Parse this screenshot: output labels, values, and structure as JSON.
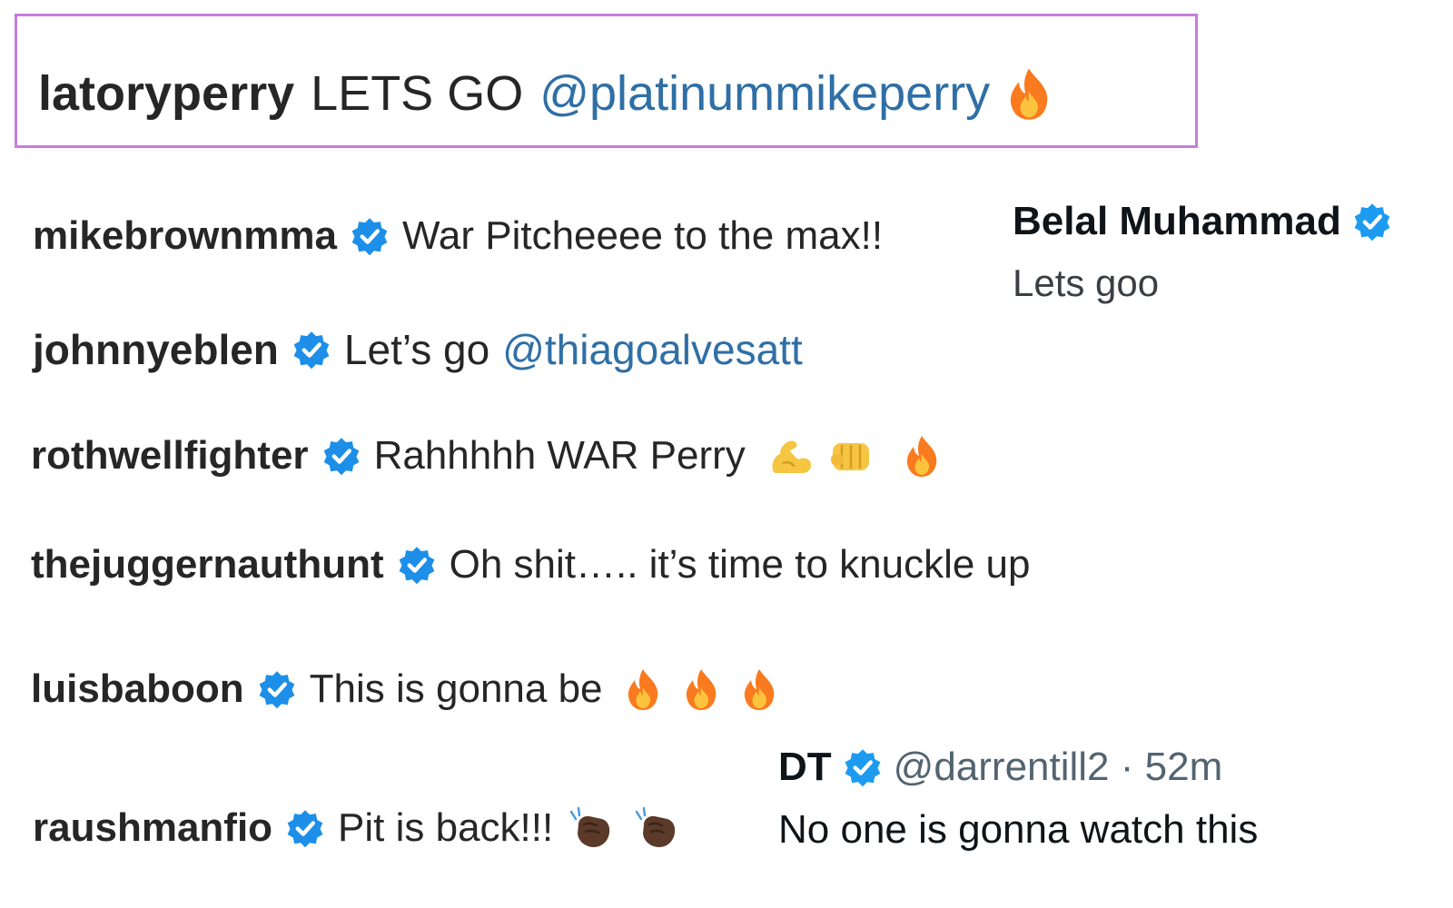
{
  "highlight": {
    "username": "latoryperry",
    "text": "LETS GO",
    "mention": "@platinummikeperry",
    "emoji": "fire"
  },
  "comments": [
    {
      "username": "mikebrownmma",
      "verified": true,
      "text": "War Pitcheeee to the max!!"
    },
    {
      "username": "johnnyeblen",
      "verified": true,
      "text": "Let’s go",
      "mention": "@thiagoalvesatt"
    },
    {
      "username": "rothwellfighter",
      "verified": true,
      "text": "Rahhhhh WAR Perry",
      "emojis": [
        "flexed-biceps",
        "raised-fist",
        "fire"
      ]
    },
    {
      "username": "thejuggernauthunt",
      "verified": true,
      "text": "Oh shit….. it’s time to knuckle up"
    },
    {
      "username": "luisbaboon",
      "verified": true,
      "text": "This is gonna be",
      "emojis": [
        "fire",
        "fire",
        "fire"
      ]
    },
    {
      "username": "raushmanfio",
      "verified": true,
      "text": "Pit is back!!!",
      "emojis": [
        "clapping-hands",
        "clapping-hands"
      ]
    }
  ],
  "tweet_belal": {
    "name": "Belal Muhammad",
    "verified": true,
    "text": "Lets goo"
  },
  "tweet_dt": {
    "name": "DT",
    "verified": true,
    "handle_time": "@darrentill2 · 52m",
    "text": "No one is gonna watch this"
  },
  "colors": {
    "instagram_verified": "#1d8fe8",
    "twitter_verified": "#1d9bf0",
    "mention": "#2f6fa6",
    "highlight_border": "#c77ddf",
    "fire": "#f97a1f"
  }
}
